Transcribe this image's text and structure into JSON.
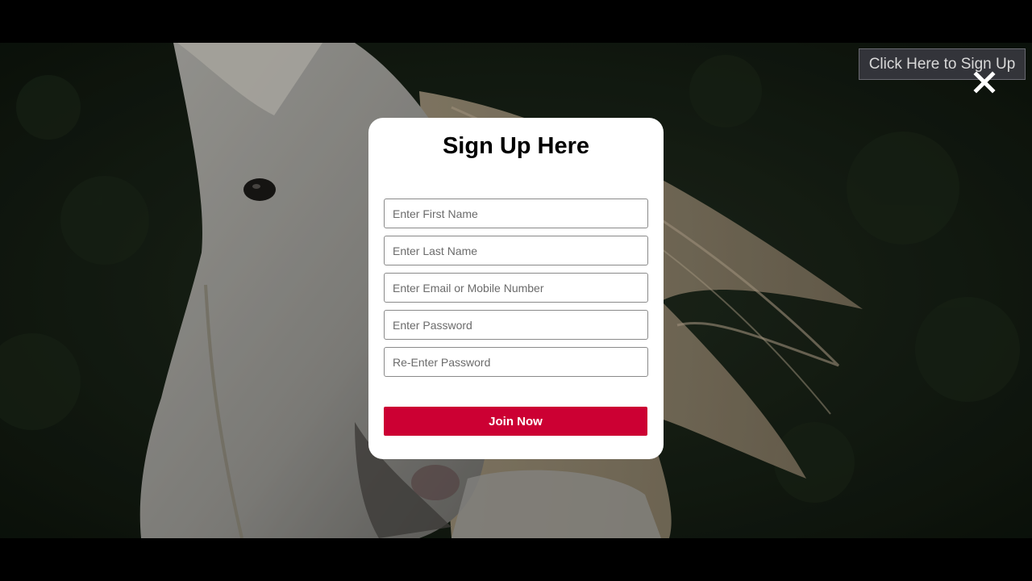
{
  "page": {
    "open_signup_label": "Click Here to Sign Up",
    "close_icon": "close-icon"
  },
  "modal": {
    "title": "Sign Up Here",
    "fields": {
      "first_name": {
        "value": "",
        "placeholder": "Enter First Name"
      },
      "last_name": {
        "value": "",
        "placeholder": "Enter Last Name"
      },
      "email": {
        "value": "",
        "placeholder": "Enter Email or Mobile Number"
      },
      "password": {
        "value": "",
        "placeholder": "Enter Password"
      },
      "confirm_password": {
        "value": "",
        "placeholder": "Re-Enter Password"
      }
    },
    "submit_label": "Join Now"
  },
  "colors": {
    "accent": "#cc0033",
    "modal_bg": "#ffffff",
    "letterbox": "#000000"
  }
}
